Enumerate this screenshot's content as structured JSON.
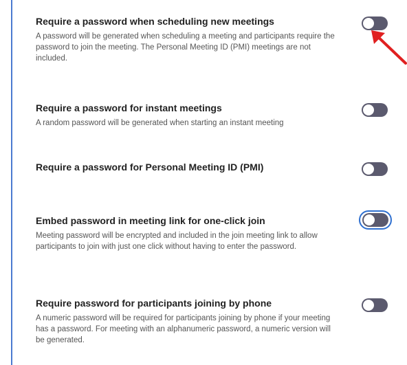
{
  "settings": [
    {
      "title": "Require a password when scheduling new meetings",
      "description": "A password will be generated when scheduling a meeting and participants require the password to join the meeting. The Personal Meeting ID (PMI) meetings are not included.",
      "enabled": false
    },
    {
      "title": "Require a password for instant meetings",
      "description": "A random password will be generated when starting an instant meeting",
      "enabled": false
    },
    {
      "title": "Require a password for Personal Meeting ID (PMI)",
      "description": "",
      "enabled": false
    },
    {
      "title": "Embed password in meeting link for one-click join",
      "description": "Meeting password will be encrypted and included in the join meeting link to allow participants to join with just one click without having to enter the password.",
      "enabled": false,
      "focused": true
    },
    {
      "title": "Require password for participants joining by phone",
      "description": "A numeric password will be required for participants joining by phone if your meeting has a password. For meeting with an alphanumeric password, a numeric version will be generated.",
      "enabled": false
    }
  ],
  "annotation": {
    "arrow_color": "#e02020",
    "arrow_icon": "red-arrow-icon"
  },
  "colors": {
    "toggle_off": "#5b5a6e",
    "focus_ring": "#2e6fd0",
    "panel_border": "#4a7ad0"
  }
}
